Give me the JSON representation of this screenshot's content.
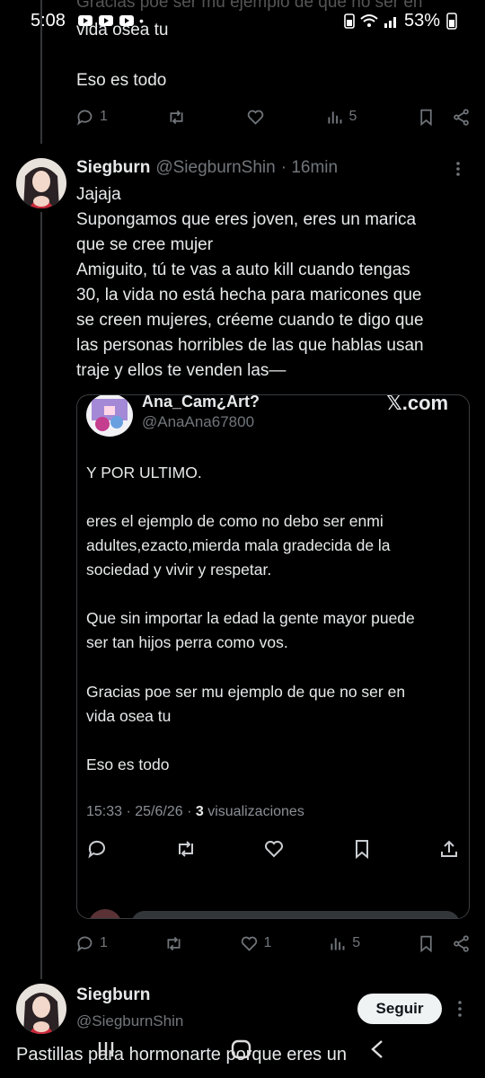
{
  "status_bar": {
    "time": "5:08",
    "battery": "53%"
  },
  "top_tweet": {
    "clipped_line": "Gracias poe ser mu ejemplo de que no ser en",
    "line2": "vida osea tu",
    "line3": "Eso es todo",
    "replies": "1",
    "views": "5"
  },
  "reply_tweet": {
    "display_name": "Siegburn",
    "handle": "@SiegburnShin",
    "time": "· 16min",
    "lines": [
      "Jajaja",
      "Supongamos que eres joven, eres un marica",
      "que se cree mujer",
      "Amiguito, tú te vas a auto kill cuando tengas",
      "30, la vida no está hecha para maricones que",
      "se creen mujeres, créeme cuando te digo que",
      "las personas horribles de las que hablas usan",
      "traje y ellos te venden las—"
    ],
    "replies": "1",
    "likes": "1",
    "views": "5"
  },
  "quoted_tweet": {
    "display_name": "Ana_Cam¿Art?",
    "handle": "@AnaAna67800",
    "watermark": "𝕏.com",
    "paragraphs": [
      [
        "Y POR ULTIMO."
      ],
      [
        "eres el ejemplo de como no debo ser enmi",
        "adultes,ezacto,mierda mala gradecida de la",
        "sociedad y vivir y respetar."
      ],
      [
        "Que sin importar la edad la gente mayor puede",
        "ser tan hijos perra como vos."
      ],
      [
        "Gracias poe ser mu ejemplo de que no ser en",
        "vida osea tu"
      ],
      [
        "Eso es todo"
      ]
    ],
    "meta_time": "15:33 · 25/6/26 · ",
    "meta_views_count": "3",
    "meta_views_label": " visualizaciones"
  },
  "bottom_tweet": {
    "display_name": "Siegburn",
    "handle": "@SiegburnShin",
    "follow_label": "Seguir",
    "text_line": "Pastillas para hormonarte porque eres un"
  },
  "colors": {
    "background": "#000000",
    "text": "#e7e9ea",
    "muted": "#71767b",
    "border": "#3a3d41",
    "follow_bg": "#eff3f4"
  }
}
